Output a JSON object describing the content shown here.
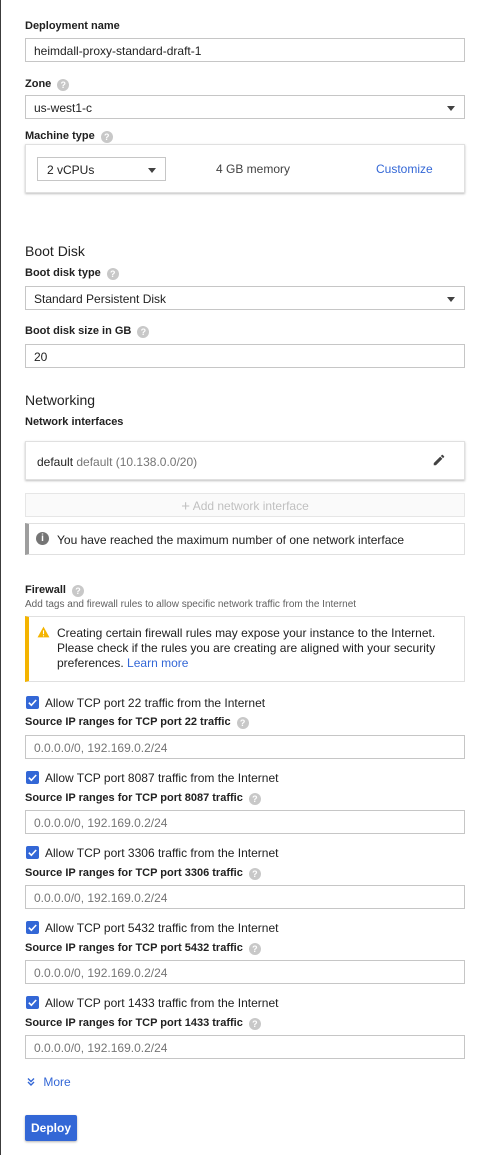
{
  "deployment": {
    "label": "Deployment name",
    "value": "heimdall-proxy-standard-draft-1"
  },
  "zone": {
    "label": "Zone",
    "value": "us-west1-c"
  },
  "machine_type": {
    "label": "Machine type",
    "cpus": "2 vCPUs",
    "memory": "4 GB memory",
    "customize": "Customize"
  },
  "boot_disk": {
    "heading": "Boot Disk",
    "type_label": "Boot disk type",
    "type_value": "Standard Persistent Disk",
    "size_label": "Boot disk size in GB",
    "size_value": "20"
  },
  "networking": {
    "heading": "Networking",
    "interfaces_label": "Network interfaces",
    "interface_name": "default",
    "interface_detail": "default (10.138.0.0/20)",
    "add_button": "Add network interface",
    "info": "You have reached the maximum number of one network interface"
  },
  "firewall": {
    "label": "Firewall",
    "description": "Add tags and firewall rules to allow specific network traffic from the Internet",
    "warning_line1": "Creating certain firewall rules may expose your instance to the Internet.",
    "warning_line2": "Please check if the rules you are creating are aligned with your security",
    "warning_line3": "preferences.",
    "learn_more": "Learn more",
    "rules": [
      {
        "allow_label": "Allow TCP port 22 traffic from the Internet",
        "checked": true,
        "source_label": "Source IP ranges for TCP port 22 traffic",
        "placeholder": "0.0.0.0/0, 192.169.0.2/24"
      },
      {
        "allow_label": "Allow TCP port 8087 traffic from the Internet",
        "checked": true,
        "source_label": "Source IP ranges for TCP port 8087 traffic",
        "placeholder": "0.0.0.0/0, 192.169.0.2/24"
      },
      {
        "allow_label": "Allow TCP port 3306 traffic from the Internet",
        "checked": true,
        "source_label": "Source IP ranges for TCP port 3306 traffic",
        "placeholder": "0.0.0.0/0, 192.169.0.2/24"
      },
      {
        "allow_label": "Allow TCP port 5432 traffic from the Internet",
        "checked": true,
        "source_label": "Source IP ranges for TCP port 5432 traffic",
        "placeholder": "0.0.0.0/0, 192.169.0.2/24"
      },
      {
        "allow_label": "Allow TCP port 1433 traffic from the Internet",
        "checked": true,
        "source_label": "Source IP ranges for TCP port 1433 traffic",
        "placeholder": "0.0.0.0/0, 192.169.0.2/24"
      }
    ]
  },
  "more": "More",
  "deploy": "Deploy",
  "colors": {
    "accent": "#3367d6",
    "warning": "#f4b400",
    "info_icon": "#757575",
    "border": "#c6c6c6"
  }
}
